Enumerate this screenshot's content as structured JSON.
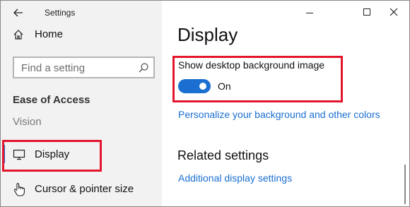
{
  "window": {
    "title": "Settings"
  },
  "sidebar": {
    "home_label": "Home",
    "search_placeholder": "Find a setting",
    "section_label": "Ease of Access",
    "items": [
      {
        "label": "Vision",
        "icon": "none"
      },
      {
        "label": "Display",
        "icon": "monitor-icon",
        "selected": true
      },
      {
        "label": "Cursor & pointer size",
        "icon": "cursor-icon"
      }
    ]
  },
  "main": {
    "title": "Display",
    "setting": {
      "label": "Show desktop background image",
      "state_label": "On",
      "enabled": true
    },
    "personalize_link": "Personalize your background and other colors",
    "related": {
      "heading": "Related settings",
      "link": "Additional display settings"
    }
  },
  "colors": {
    "accent": "#1a6fd1",
    "highlight": "#e3162d",
    "sidebar_bg": "#f2f2f2"
  }
}
